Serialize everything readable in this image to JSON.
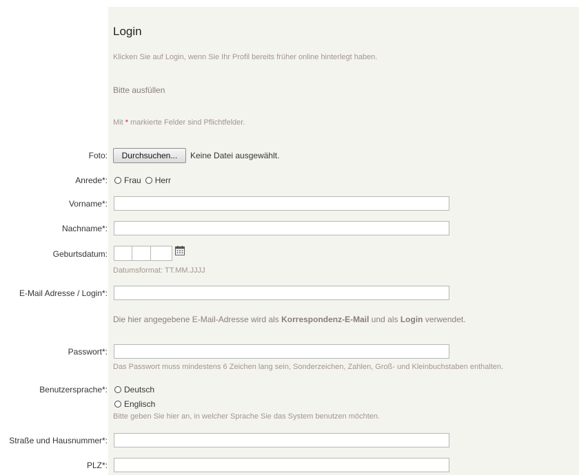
{
  "heading": "Login",
  "login_hint": "Klicken Sie auf Login, wenn Sie Ihr Profil bereits früher online hinterlegt haben.",
  "fill_prompt": "Bitte ausfüllen",
  "required_note": {
    "prefix": "Mit ",
    "star": "*",
    "suffix": " markierte Felder sind Pflichtfelder."
  },
  "photo": {
    "label": "Foto:",
    "button": "Durchsuchen...",
    "status": "Keine Datei ausgewählt."
  },
  "salutation": {
    "label": "Anrede*:",
    "options": [
      "Frau",
      "Herr"
    ]
  },
  "first_name": {
    "label": "Vorname*:",
    "value": ""
  },
  "last_name": {
    "label": "Nachname*:",
    "value": ""
  },
  "birthdate": {
    "label": "Geburtsdatum:",
    "day": "",
    "month": "",
    "year": "",
    "separator": ".",
    "format_hint": "Datumsformat: TT.MM.JJJJ",
    "icon": "calendar-icon"
  },
  "email": {
    "label": "E-Mail Adresse / Login*:",
    "value": "",
    "hint_prefix": "Die hier angegebene E-Mail-Adresse wird als ",
    "hint_bold1": "Korrespondenz-E-Mail",
    "hint_middle": " und als ",
    "hint_bold2": "Login",
    "hint_suffix": " verwendet."
  },
  "password": {
    "label": "Passwort*:",
    "value": "",
    "hint": "Das Passwort muss mindestens 6 Zeichen lang sein, Sonderzeichen, Zahlen, Groß- und Kleinbuchstaben enthalten."
  },
  "language": {
    "label": "Benutzersprache*:",
    "options": [
      "Deutsch",
      "Englisch"
    ],
    "hint": "Bitte geben Sie hier an, in welcher Sprache Sie das System benutzen möchten."
  },
  "street": {
    "label": "Straße und Hausnummer*:",
    "value": ""
  },
  "zip": {
    "label": "PLZ*:",
    "value": ""
  }
}
